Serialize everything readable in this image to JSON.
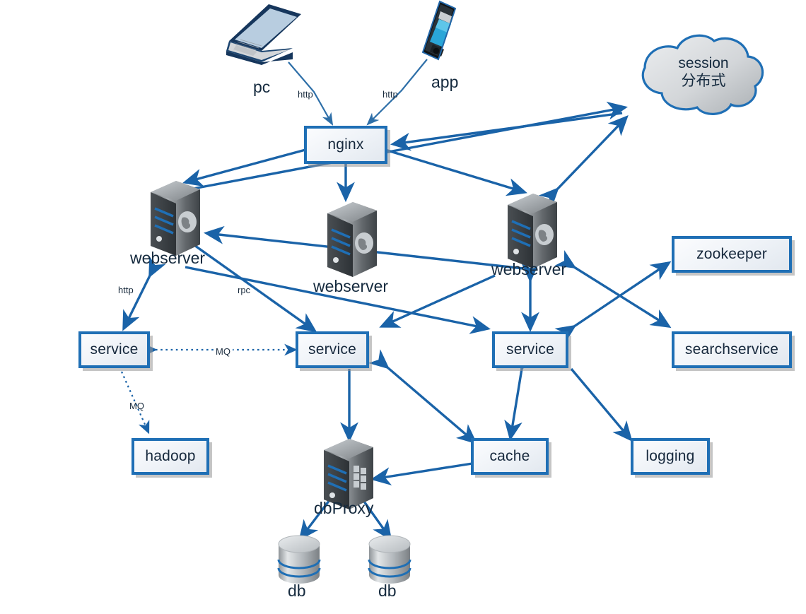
{
  "diagram": {
    "title": "distributed web architecture",
    "accent": "#1F6FB5",
    "text_color": "#152a3e"
  },
  "nodes": {
    "pc": "pc",
    "app": "app",
    "nginx": "nginx",
    "session_line1": "session",
    "session_line2": "分布式",
    "webserver_left": "webserver",
    "webserver_mid": "webserver",
    "webserver_right": "webserver",
    "zookeeper": "zookeeper",
    "searchservice": "searchservice",
    "service_left": "service",
    "service_mid": "service",
    "service_right": "service",
    "hadoop": "hadoop",
    "cache": "cache",
    "logging": "logging",
    "dbproxy": "dbProxy",
    "db_left": "db",
    "db_right": "db"
  },
  "edge_labels": {
    "http_pc": "http",
    "http_app": "http",
    "http_service": "http",
    "rpc": "rpc",
    "mq_service": "MQ",
    "mq_hadoop": "MQ"
  }
}
